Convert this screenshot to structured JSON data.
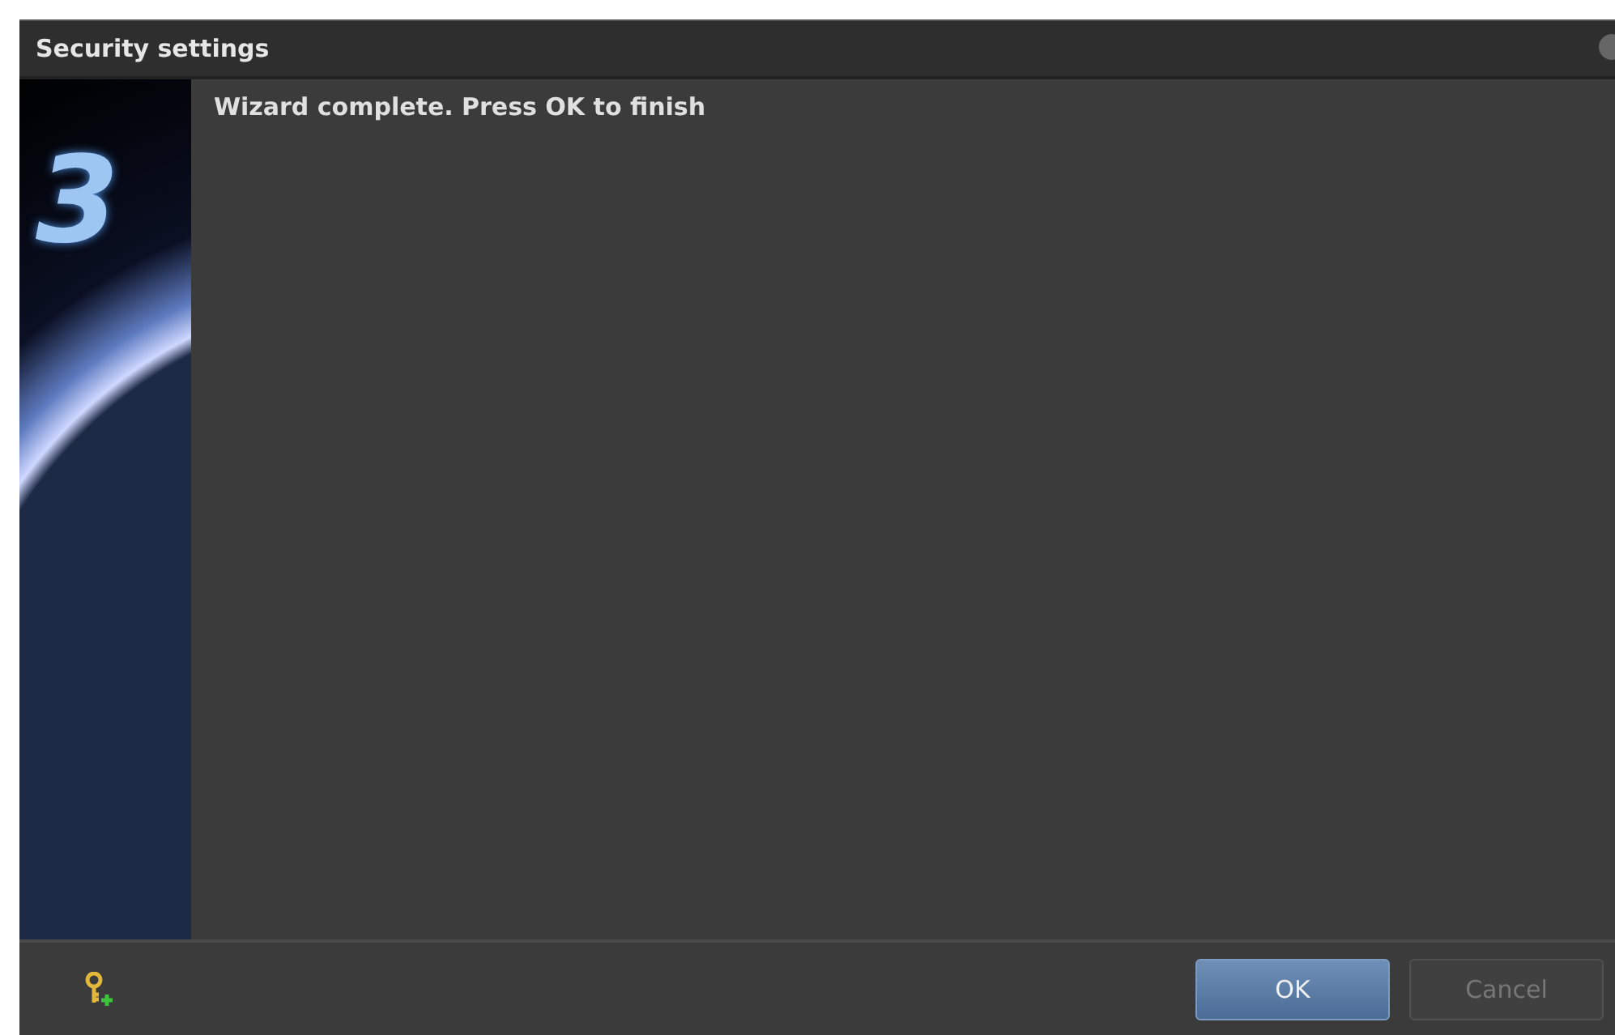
{
  "window": {
    "title": "Security settings"
  },
  "banner": {
    "logo_text": "3"
  },
  "message": "Wizard complete. Press OK to finish",
  "buttons": [
    {
      "label": "OK",
      "kind": "primary",
      "disabled": false
    },
    {
      "label": "Cancel",
      "kind": "secondary",
      "disabled": true
    }
  ]
}
